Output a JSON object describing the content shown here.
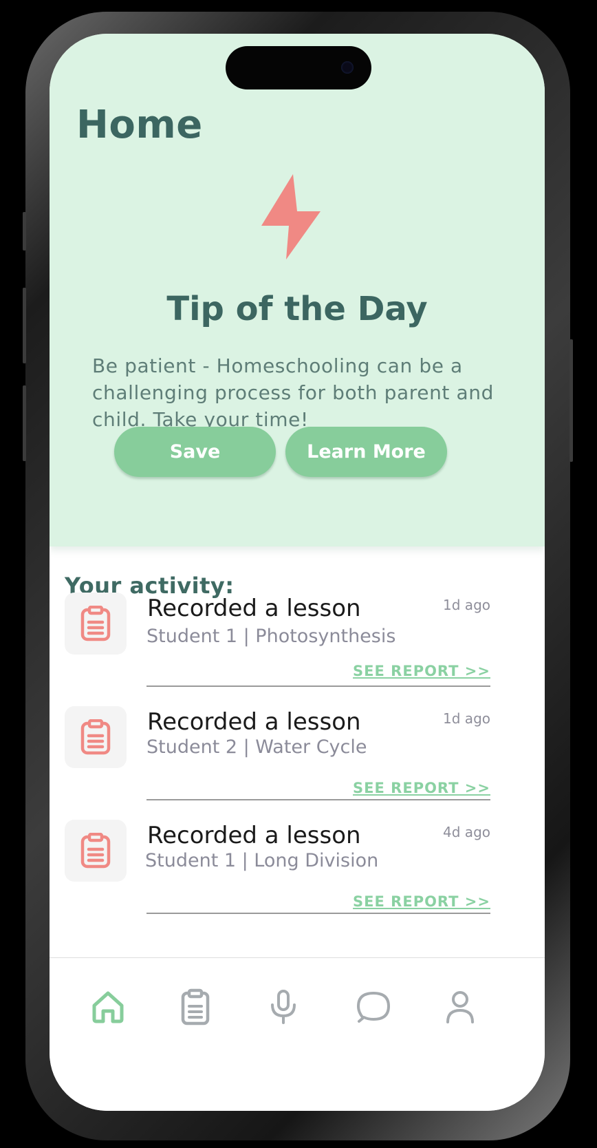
{
  "page": {
    "title": "Home"
  },
  "tip": {
    "heading": "Tip of the Day",
    "body": "Be patient - Homeschooling can be a challenging process for both parent and child. Take your time!",
    "save_label": "Save",
    "learn_more_label": "Learn More"
  },
  "activity": {
    "title": "Your activity:",
    "items": [
      {
        "title": "Recorded a lesson",
        "subtitle": "Student 1 | Photosynthesis",
        "time": "1d ago",
        "link": "SEE REPORT >>"
      },
      {
        "title": "Recorded a lesson",
        "subtitle": "Student 2 | Water Cycle",
        "time": "1d ago",
        "link": "SEE REPORT >>"
      },
      {
        "title": "Recorded a lesson",
        "subtitle": "Student 1 | Long Division",
        "time": "4d ago",
        "link": "SEE REPORT >>"
      }
    ]
  },
  "tabs": [
    {
      "icon": "home-icon",
      "active": true
    },
    {
      "icon": "clipboard-icon",
      "active": false
    },
    {
      "icon": "microphone-icon",
      "active": false
    },
    {
      "icon": "chat-bubble-icon",
      "active": false
    },
    {
      "icon": "profile-icon",
      "active": false
    }
  ],
  "colors": {
    "hero_bg": "#dbf3e3",
    "accent_green": "#87cd9b",
    "title_teal": "#3c6661",
    "coral": "#f08984",
    "inactive_icon": "#a6abaf"
  }
}
